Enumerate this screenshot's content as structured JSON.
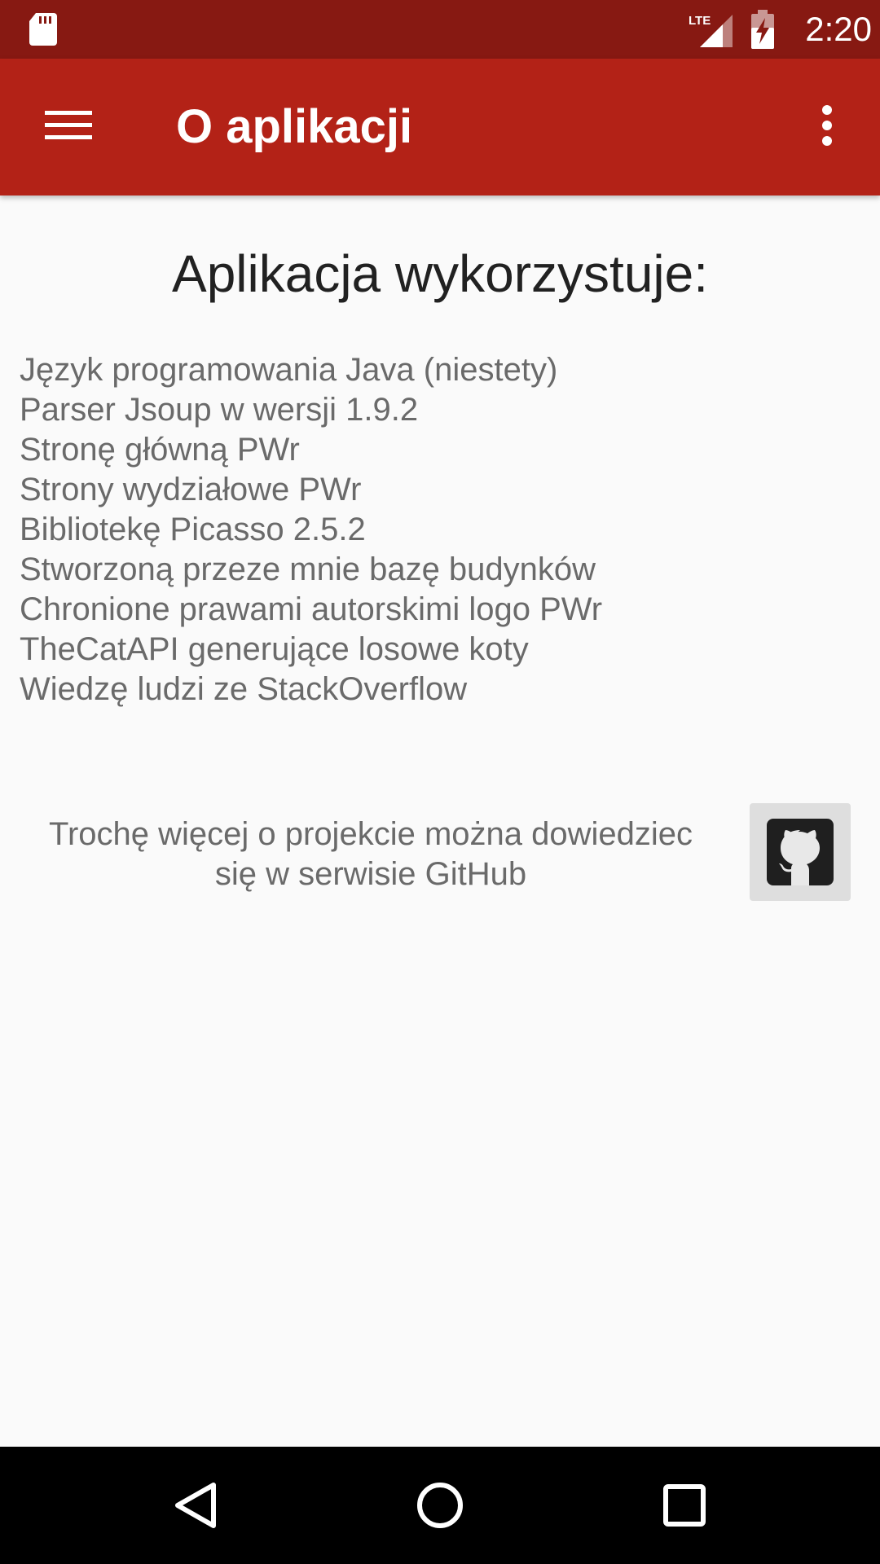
{
  "status_bar": {
    "time": "2:20",
    "network_label": "LTE",
    "icons": [
      "sd-card-icon",
      "lte-signal-icon",
      "battery-charging-icon"
    ]
  },
  "app_bar": {
    "title": "O aplikacji",
    "menu_icon": "hamburger-menu-icon",
    "overflow_icon": "more-vert-icon",
    "background_color": "#b32217",
    "status_color": "#871912"
  },
  "content": {
    "heading": "Aplikacja wykorzystuje:",
    "items": [
      "Język programowania Java (niestety)",
      "Parser Jsoup w wersji 1.9.2",
      "Stronę główną PWr",
      "Strony wydziałowe PWr",
      "Bibliotekę Picasso 2.5.2",
      "Stworzoną przeze mnie bazę budynków",
      "Chronione prawami autorskimi logo PWr",
      "TheCatAPI generujące losowe koty",
      "Wiedzę ludzi ze StackOverflow"
    ],
    "github_text_line1": "Trochę więcej o projekcie można dowiedziec",
    "github_text_line2": "się w serwisie GitHub",
    "github_icon": "github-icon"
  },
  "nav_bar": {
    "icons": [
      "back-icon",
      "home-icon",
      "recents-icon"
    ]
  }
}
